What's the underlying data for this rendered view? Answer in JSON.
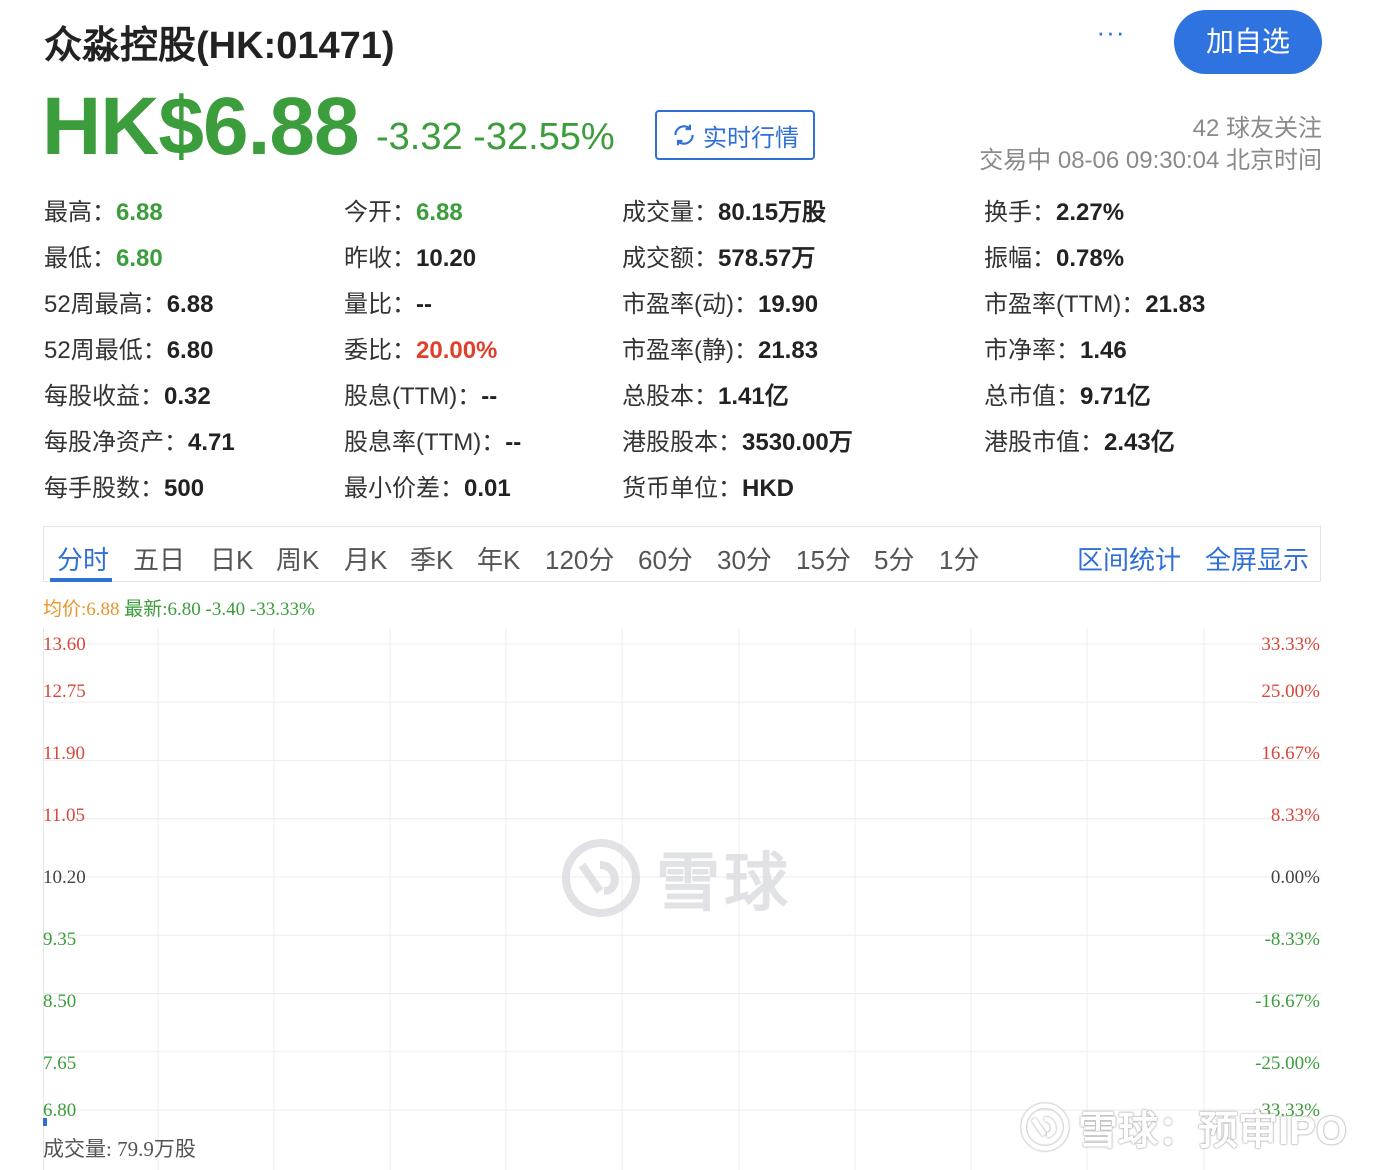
{
  "header": {
    "title": "众淼控股(HK:01471)",
    "more_label": "···",
    "follow_label": "加自选",
    "price": "HK$6.88",
    "change": "-3.32 -32.55%",
    "realtime_label": "实时行情",
    "followers": "42 球友关注",
    "trade_time": "交易中 08-06 09:30:04 北京时间"
  },
  "stats": [
    {
      "label": "最高：",
      "value": "6.88",
      "color": "green"
    },
    {
      "label": "今开：",
      "value": "6.88",
      "color": "green"
    },
    {
      "label": "成交量：",
      "value": "80.15万股",
      "color": "default"
    },
    {
      "label": "换手：",
      "value": "2.27%",
      "color": "default"
    },
    {
      "label": "最低：",
      "value": "6.80",
      "color": "green"
    },
    {
      "label": "昨收：",
      "value": "10.20",
      "color": "default"
    },
    {
      "label": "成交额：",
      "value": "578.57万",
      "color": "default"
    },
    {
      "label": "振幅：",
      "value": "0.78%",
      "color": "default"
    },
    {
      "label": "52周最高：",
      "value": "6.88",
      "color": "default"
    },
    {
      "label": "量比：",
      "value": "--",
      "color": "default"
    },
    {
      "label": "市盈率(动)：",
      "value": "19.90",
      "color": "default"
    },
    {
      "label": "市盈率(TTM)：",
      "value": "21.83",
      "color": "default"
    },
    {
      "label": "52周最低：",
      "value": "6.80",
      "color": "default"
    },
    {
      "label": "委比：",
      "value": "20.00%",
      "color": "red"
    },
    {
      "label": "市盈率(静)：",
      "value": "21.83",
      "color": "default"
    },
    {
      "label": "市净率：",
      "value": "1.46",
      "color": "default"
    },
    {
      "label": "每股收益：",
      "value": "0.32",
      "color": "default"
    },
    {
      "label": "股息(TTM)：",
      "value": "--",
      "color": "default"
    },
    {
      "label": "总股本：",
      "value": "1.41亿",
      "color": "default"
    },
    {
      "label": "总市值：",
      "value": "9.71亿",
      "color": "default"
    },
    {
      "label": "每股净资产：",
      "value": "4.71",
      "color": "default"
    },
    {
      "label": "股息率(TTM)：",
      "value": "--",
      "color": "default"
    },
    {
      "label": "港股股本：",
      "value": "3530.00万",
      "color": "default"
    },
    {
      "label": "港股市值：",
      "value": "2.43亿",
      "color": "default"
    },
    {
      "label": "每手股数：",
      "value": "500",
      "color": "default"
    },
    {
      "label": "最小价差：",
      "value": "0.01",
      "color": "default"
    },
    {
      "label": "货币单位：",
      "value": "HKD",
      "color": "default"
    }
  ],
  "tabs": [
    "分时",
    "五日",
    "日K",
    "周K",
    "月K",
    "季K",
    "年K",
    "120分",
    "60分",
    "30分",
    "15分",
    "5分",
    "1分"
  ],
  "active_tab": "分时",
  "tab_actions": [
    "区间统计",
    "全屏显示"
  ],
  "chart": {
    "legend_avg": "均价:6.88",
    "legend_latest": "最新:6.80 -3.40 -33.33%",
    "volume_label": "成交量: 79.9万股",
    "watermark": "雪球",
    "corner_watermark": "雪球：预审IPO",
    "colors": {
      "up": "#d9473a",
      "down": "#3b9d3b",
      "flat": "#444444",
      "avg": "#e8962a",
      "accent": "#2f6fd6"
    }
  },
  "chart_data": {
    "type": "line",
    "title": "",
    "xlabel": "",
    "ylabel": "",
    "y_left_ticks": [
      "13.60",
      "12.75",
      "11.90",
      "11.05",
      "10.20",
      "9.35",
      "8.50",
      "7.65",
      "6.80"
    ],
    "y_right_ticks": [
      "33.33%",
      "25.00%",
      "16.67%",
      "8.33%",
      "0.00%",
      "-8.33%",
      "-16.67%",
      "-25.00%",
      "-33.33%"
    ],
    "ylim": [
      6.8,
      13.6
    ],
    "prev_close": 10.2,
    "series": [
      {
        "name": "最新",
        "values": [
          6.8
        ]
      }
    ],
    "grid": true
  }
}
